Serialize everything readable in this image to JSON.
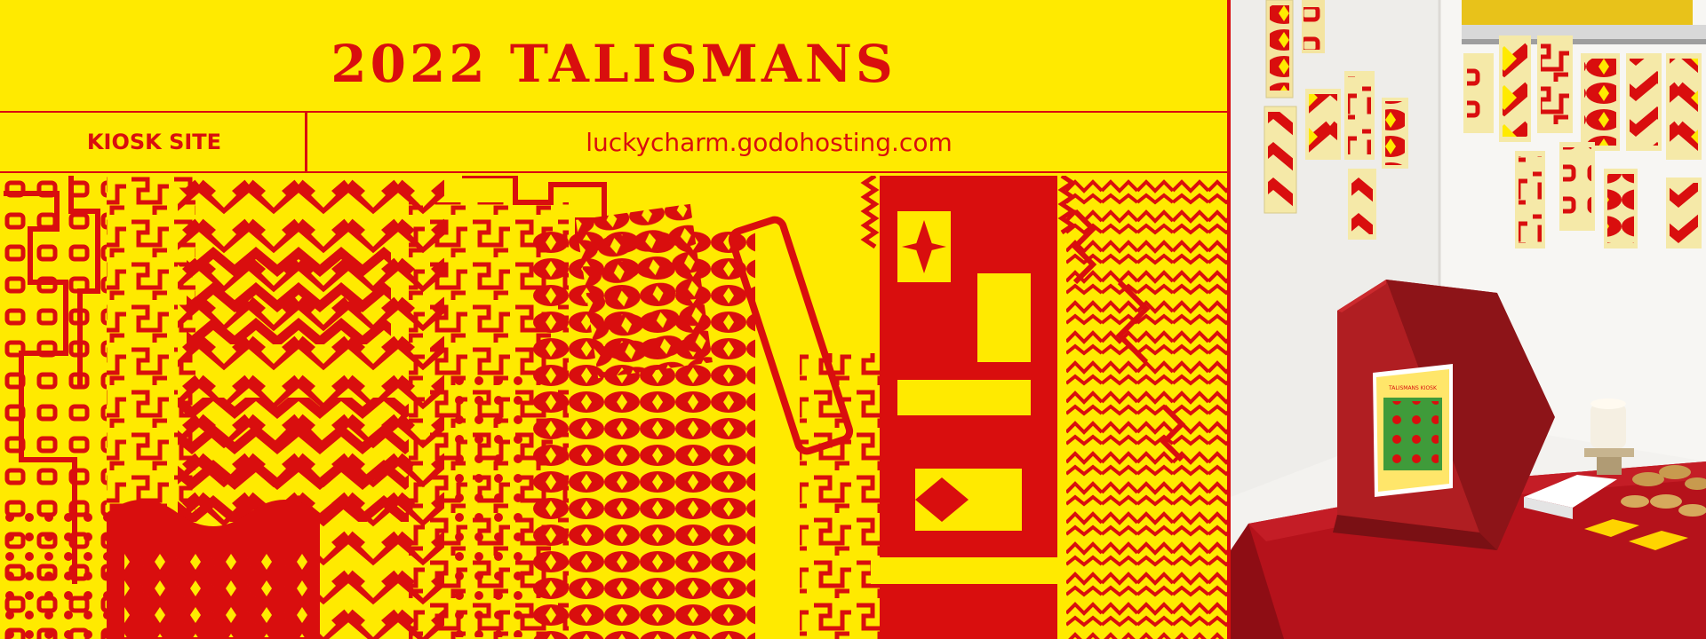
{
  "poster": {
    "title": "2022 TALISMANS",
    "kiosk_label": "KIOSK SITE",
    "url": "luckycharm.godohosting.com"
  },
  "kiosk_sign": {
    "heading": "TALISMANS KIOSK"
  },
  "colors": {
    "background_yellow": "#FFEA00",
    "accent_red": "#D90E0E",
    "tablecloth": "#B5121B",
    "kiosk_box": "#B01E22"
  }
}
